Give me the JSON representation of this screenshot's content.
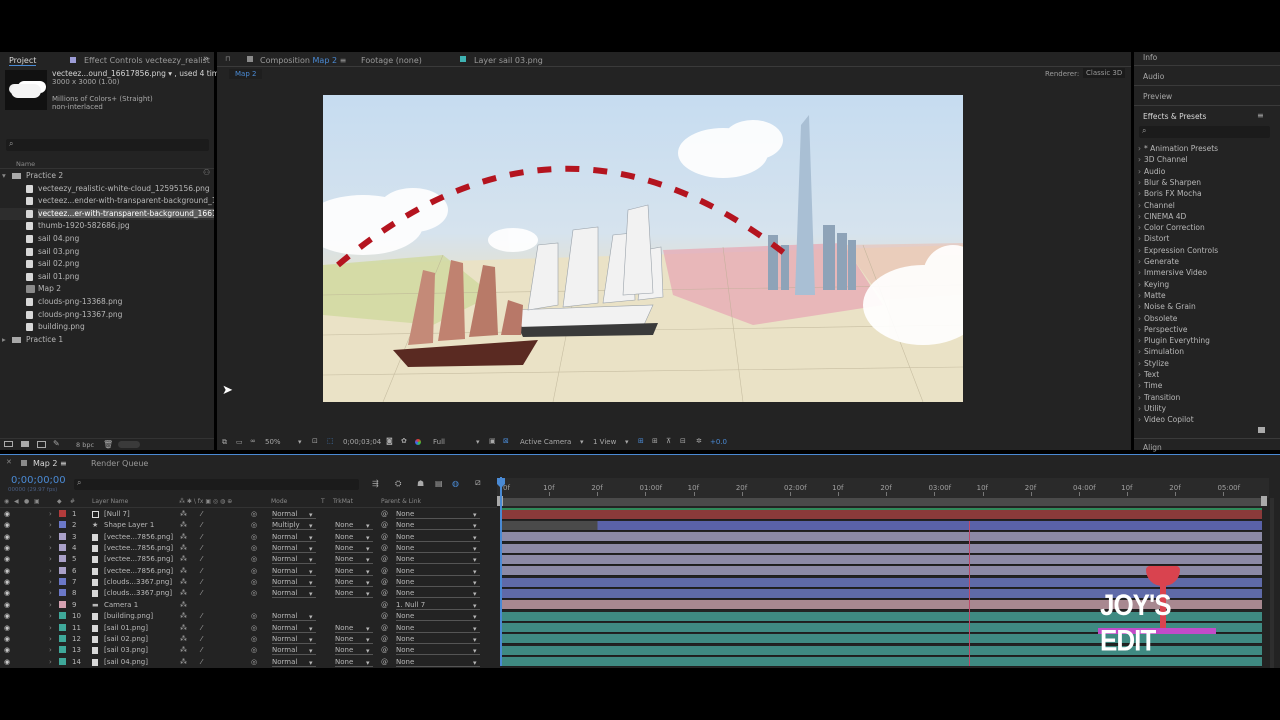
{
  "project_panel": {
    "tab_project": "Project",
    "tab_effect_controls": "Effect Controls vecteezy_realist",
    "selected_file": "vecteez...ound_16617856.png",
    "used_count": ", used 4 times",
    "dimensions": "3000 x 3000 (1.00)",
    "colors": "Millions of Colors+ (Straight)",
    "interlace": "non-interlaced",
    "name_header": "Name",
    "bpc": "8 bpc",
    "items": [
      {
        "type": "folder",
        "label": "Practice 2",
        "indent": 0
      },
      {
        "type": "file",
        "label": "vecteezy_realistic-white-cloud_12595156.png",
        "indent": 1
      },
      {
        "type": "file",
        "label": "vecteez...ender-with-transparent-background_166",
        "indent": 1
      },
      {
        "type": "file",
        "label": "vecteez...er-with-transparent-background_1661",
        "indent": 1,
        "selected": true
      },
      {
        "type": "file",
        "label": "thumb-1920-582686.jpg",
        "indent": 1
      },
      {
        "type": "file",
        "label": "sail 04.png",
        "indent": 1
      },
      {
        "type": "file",
        "label": "sail 03.png",
        "indent": 1
      },
      {
        "type": "file",
        "label": "sail 02.png",
        "indent": 1
      },
      {
        "type": "file",
        "label": "sail 01.png",
        "indent": 1
      },
      {
        "type": "comp",
        "label": "Map 2",
        "indent": 1
      },
      {
        "type": "file",
        "label": "clouds-png-13368.png",
        "indent": 1
      },
      {
        "type": "file",
        "label": "clouds-png-13367.png",
        "indent": 1
      },
      {
        "type": "file",
        "label": "building.png",
        "indent": 1
      },
      {
        "type": "folder",
        "label": "Practice 1",
        "indent": 0
      }
    ]
  },
  "composition_panel": {
    "tab_composition": "Composition",
    "comp_name": "Map 2",
    "tab_footage": "Footage  (none)",
    "tab_layer": "Layer  sail 03.png",
    "breadcrumb": "Map 2",
    "renderer_label": "Renderer:",
    "renderer_value": "Classic 3D",
    "zoom": "50%",
    "timecode": "0;00;03;04",
    "resolution": "Full",
    "camera": "Active Camera",
    "view": "1 View",
    "exposure": "+0.0"
  },
  "right_panel": {
    "info": "Info",
    "audio": "Audio",
    "preview": "Preview",
    "effects_presets": "Effects & Presets",
    "align": "Align",
    "effects": [
      "* Animation Presets",
      "3D Channel",
      "Audio",
      "Blur & Sharpen",
      "Boris FX Mocha",
      "Channel",
      "CINEMA 4D",
      "Color Correction",
      "Distort",
      "Expression Controls",
      "Generate",
      "Immersive Video",
      "Keying",
      "Matte",
      "Noise & Grain",
      "Obsolete",
      "Perspective",
      "Plugin Everything",
      "Simulation",
      "Stylize",
      "Text",
      "Time",
      "Transition",
      "Utility",
      "Video Copilot"
    ]
  },
  "timeline": {
    "tab_comp": "Map 2",
    "tab_render_queue": "Render Queue",
    "timecode": "0;00;00;00",
    "frame_info": "00000 (29.97 fps)",
    "headers": {
      "layer_name": "Layer Name",
      "mode": "Mode",
      "t": "T",
      "trkmat": "TrkMat",
      "parent": "Parent & Link"
    },
    "ruler_labels": [
      "0f",
      "10f",
      "20f",
      "01:00f",
      "10f",
      "20f",
      "02:00f",
      "10f",
      "20f",
      "03:00f",
      "10f",
      "20f",
      "04:00f",
      "10f",
      "20f",
      "05:00f"
    ],
    "layers": [
      {
        "num": "1",
        "name": "[Null 7]",
        "color": "#b23b3b",
        "icon": "null-icon",
        "mode": "Normal",
        "trkmat": "",
        "parent": "None",
        "bar_color": "#7a3535"
      },
      {
        "num": "2",
        "name": "Shape Layer 1",
        "color": "#6b78c8",
        "icon": "star-icon",
        "mode": "Multiply",
        "trkmat": "None",
        "parent": "None",
        "bar_color": "#5a62a8"
      },
      {
        "num": "3",
        "name": "[vectee...7856.png]",
        "color": "#a9a0c8",
        "icon": "file-icon",
        "mode": "Normal",
        "trkmat": "None",
        "parent": "None",
        "bar_color": "#8c8aa6"
      },
      {
        "num": "4",
        "name": "[vectee...7856.png]",
        "color": "#a9a0c8",
        "icon": "file-icon",
        "mode": "Normal",
        "trkmat": "None",
        "parent": "None",
        "bar_color": "#8c8aa6"
      },
      {
        "num": "5",
        "name": "[vectee...7856.png]",
        "color": "#a9a0c8",
        "icon": "file-icon",
        "mode": "Normal",
        "trkmat": "None",
        "parent": "None",
        "bar_color": "#8c8aa6"
      },
      {
        "num": "6",
        "name": "[vectee...7856.png]",
        "color": "#a9a0c8",
        "icon": "file-icon",
        "mode": "Normal",
        "trkmat": "None",
        "parent": "None",
        "bar_color": "#8c8aa6"
      },
      {
        "num": "7",
        "name": "[clouds...3367.png]",
        "color": "#6b78c8",
        "icon": "file-icon",
        "mode": "Normal",
        "trkmat": "None",
        "parent": "None",
        "bar_color": "#5f6aa8"
      },
      {
        "num": "8",
        "name": "[clouds...3367.png]",
        "color": "#6b78c8",
        "icon": "file-icon",
        "mode": "Normal",
        "trkmat": "None",
        "parent": "None",
        "bar_color": "#5f6aa8"
      },
      {
        "num": "9",
        "name": "Camera 1",
        "color": "#d4a0b0",
        "icon": "camera-icon",
        "mode": "",
        "trkmat": "",
        "parent": "1. Null 7",
        "bar_color": "#a88890"
      },
      {
        "num": "10",
        "name": "[building.png]",
        "color": "#3fa89a",
        "icon": "file-icon",
        "mode": "Normal",
        "trkmat": "",
        "parent": "None",
        "bar_color": "#3f8a82"
      },
      {
        "num": "11",
        "name": "[sail 01.png]",
        "color": "#3fa89a",
        "icon": "file-icon",
        "mode": "Normal",
        "trkmat": "None",
        "parent": "None",
        "bar_color": "#3f8a82"
      },
      {
        "num": "12",
        "name": "[sail 02.png]",
        "color": "#3fa89a",
        "icon": "file-icon",
        "mode": "Normal",
        "trkmat": "None",
        "parent": "None",
        "bar_color": "#3f8a82"
      },
      {
        "num": "13",
        "name": "[sail 03.png]",
        "color": "#3fa89a",
        "icon": "file-icon",
        "mode": "Normal",
        "trkmat": "None",
        "parent": "None",
        "bar_color": "#3f8a82"
      },
      {
        "num": "14",
        "name": "[sail 04.png]",
        "color": "#3fa89a",
        "icon": "file-icon",
        "mode": "Normal",
        "trkmat": "None",
        "parent": "None",
        "bar_color": "#3f8a82"
      }
    ]
  },
  "watermark": "JOY'S EDIT"
}
